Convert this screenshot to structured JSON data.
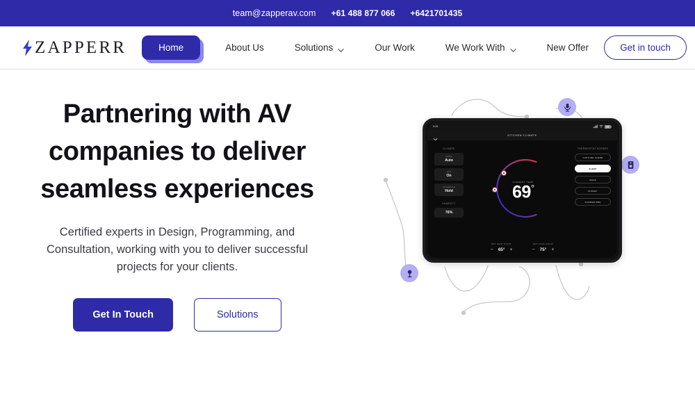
{
  "topbar": {
    "email": "team@zapperav.com",
    "phone1": "+61 488 877 066",
    "phone2": "+6421701435"
  },
  "nav": {
    "logo_text": "ZAPPERR",
    "logo_icon": "lightning-bolt-icon",
    "items": [
      {
        "label": "Home",
        "active": true,
        "dropdown": false
      },
      {
        "label": "About Us",
        "active": false,
        "dropdown": false
      },
      {
        "label": "Solutions",
        "active": false,
        "dropdown": true
      },
      {
        "label": "Our Work",
        "active": false,
        "dropdown": false
      },
      {
        "label": "We Work With",
        "active": false,
        "dropdown": true
      },
      {
        "label": "New Offer",
        "active": false,
        "dropdown": false
      }
    ],
    "cta_label": "Get in touch"
  },
  "hero": {
    "headline": "Partnering with AV companies to deliver seamless experiences",
    "subtext": "Certified experts in Design, Programming, and Consultation, working with you to deliver successful projects for your clients.",
    "primary_cta": "Get In Touch",
    "secondary_cta": "Solutions"
  },
  "device": {
    "status_time": "8:26",
    "app_title": "KITCHEN CLIMATE",
    "climate_label": "CLIMATE",
    "climate_tiles": [
      {
        "label": "MODE",
        "value": "Auto"
      },
      {
        "label": "FAN",
        "value": "On"
      },
      {
        "label": "SCHEDULE",
        "value": "Hold"
      }
    ],
    "humidity_label": "HUMIDITY",
    "humidity_value": "76%",
    "scenes_label": "THERMOSTAT SCENES",
    "scenes": [
      {
        "label": "CAPTURE SCENE",
        "selected": false
      },
      {
        "label": "SLEEP",
        "selected": true
      },
      {
        "label": "WAKE",
        "selected": false
      },
      {
        "label": "SUNSET",
        "selected": false
      },
      {
        "label": "SUMMER BBQ",
        "selected": false
      }
    ],
    "current_temp_label": "CURRENT TEMP",
    "current_temp": "69",
    "degree": "°",
    "heat_label": "SET HEAT POINT",
    "heat_value": "65°",
    "cool_label": "SET COOL POINT",
    "cool_value": "75°",
    "minus": "−",
    "plus": "+"
  },
  "decor": {
    "node_mic": "microphone-icon",
    "node_speaker": "speaker-icon",
    "node_sensor": "sensor-icon"
  },
  "colors": {
    "brand": "#2e2aa8",
    "brand_light": "#8b87ef",
    "node": "#b3aef5",
    "text": "#111118"
  }
}
